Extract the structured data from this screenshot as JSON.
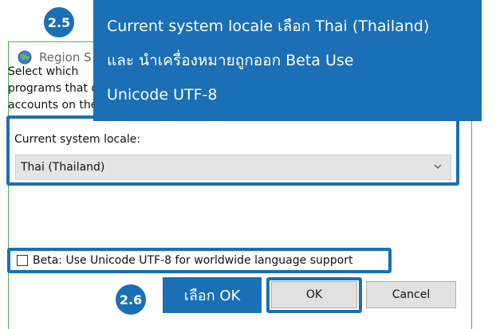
{
  "dialog": {
    "title": "Region S",
    "description_lines": [
      "Select which",
      "programs that do not support Unicode. This setting affects all user",
      "accounts on the computer."
    ],
    "locale_label": "Current system locale:",
    "locale_value": "Thai (Thailand)",
    "beta_label": "Beta: Use Unicode UTF-8 for worldwide language support",
    "beta_checked": false,
    "ok_label": "OK",
    "cancel_label": "Cancel"
  },
  "annotations": {
    "step_25": "2.5",
    "step_26": "2.6",
    "callout_lines": [
      "Current system locale เลือก Thai (Thailand)",
      "และ นำเครื่องหมายถูกออก Beta Use",
      "Unicode UTF-8"
    ],
    "callout_ok": "เลือก OK"
  },
  "colors": {
    "annotation_blue": "#1a6fb5",
    "dialog_border": "#4caf50"
  }
}
